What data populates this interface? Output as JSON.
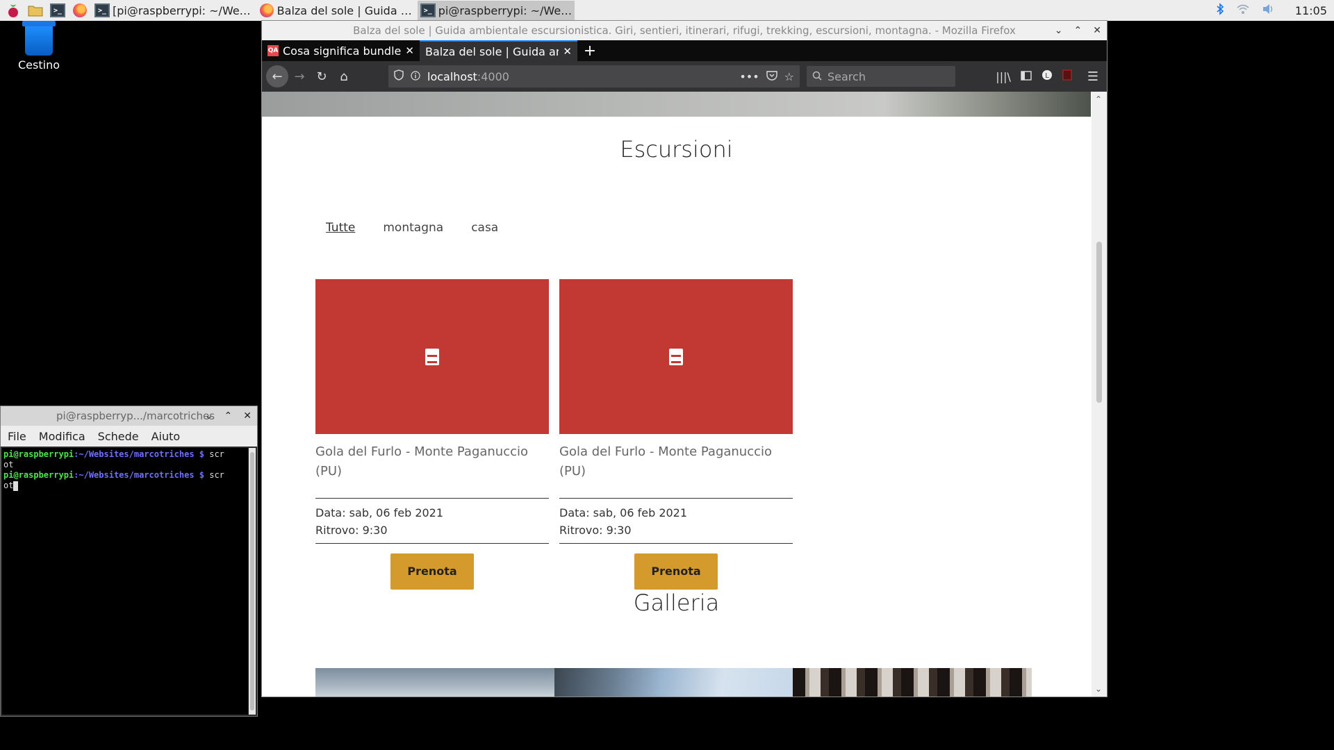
{
  "taskbar": {
    "tasks": [
      {
        "label": "[pi@raspberrypi: ~/We…",
        "icon": "terminal-icon",
        "active": false
      },
      {
        "label": "Balza del sole | Guida …",
        "icon": "firefox-icon",
        "active": false
      },
      {
        "label": "pi@raspberrypi: ~/We…",
        "icon": "terminal-icon",
        "active": true
      }
    ],
    "clock": "11:05"
  },
  "desktop": {
    "trash_label": "Cestino"
  },
  "firefox": {
    "window_title": "Balza del sole | Guida ambientale escursionistica. Giri, sentieri, itinerari, rifugi, trekking, escursioni, montagna. - Mozilla Firefox",
    "tabs": [
      {
        "label": "Cosa significa bundle e",
        "favicon": "QA"
      },
      {
        "label": "Balza del sole | Guida amb",
        "favicon": ""
      }
    ],
    "url_host": "localhost",
    "url_port": ":4000",
    "search_placeholder": "Search"
  },
  "page": {
    "section_title": "Escursioni",
    "filters": [
      "Tutte",
      "montagna",
      "casa"
    ],
    "cards": [
      {
        "title": "Gola del Furlo - Monte Paganuccio (PU)",
        "date": "Data: sab, 06 feb 2021",
        "meeting": "Ritrovo: 9:30",
        "button": "Prenota"
      },
      {
        "title": "Gola del Furlo - Monte Paganuccio (PU)",
        "date": "Data: sab, 06 feb 2021",
        "meeting": "Ritrovo: 9:30",
        "button": "Prenota"
      }
    ],
    "gallery_title": "Galleria"
  },
  "terminal": {
    "title": "pi@raspberryp.../marcotriches",
    "menu": [
      "File",
      "Modifica",
      "Schede",
      "Aiuto"
    ],
    "prompt_user": "pi@raspberrypi",
    "prompt_path": ":~/Websites/marcotriches $",
    "command_part1": "scr",
    "command_part2": "ot"
  }
}
